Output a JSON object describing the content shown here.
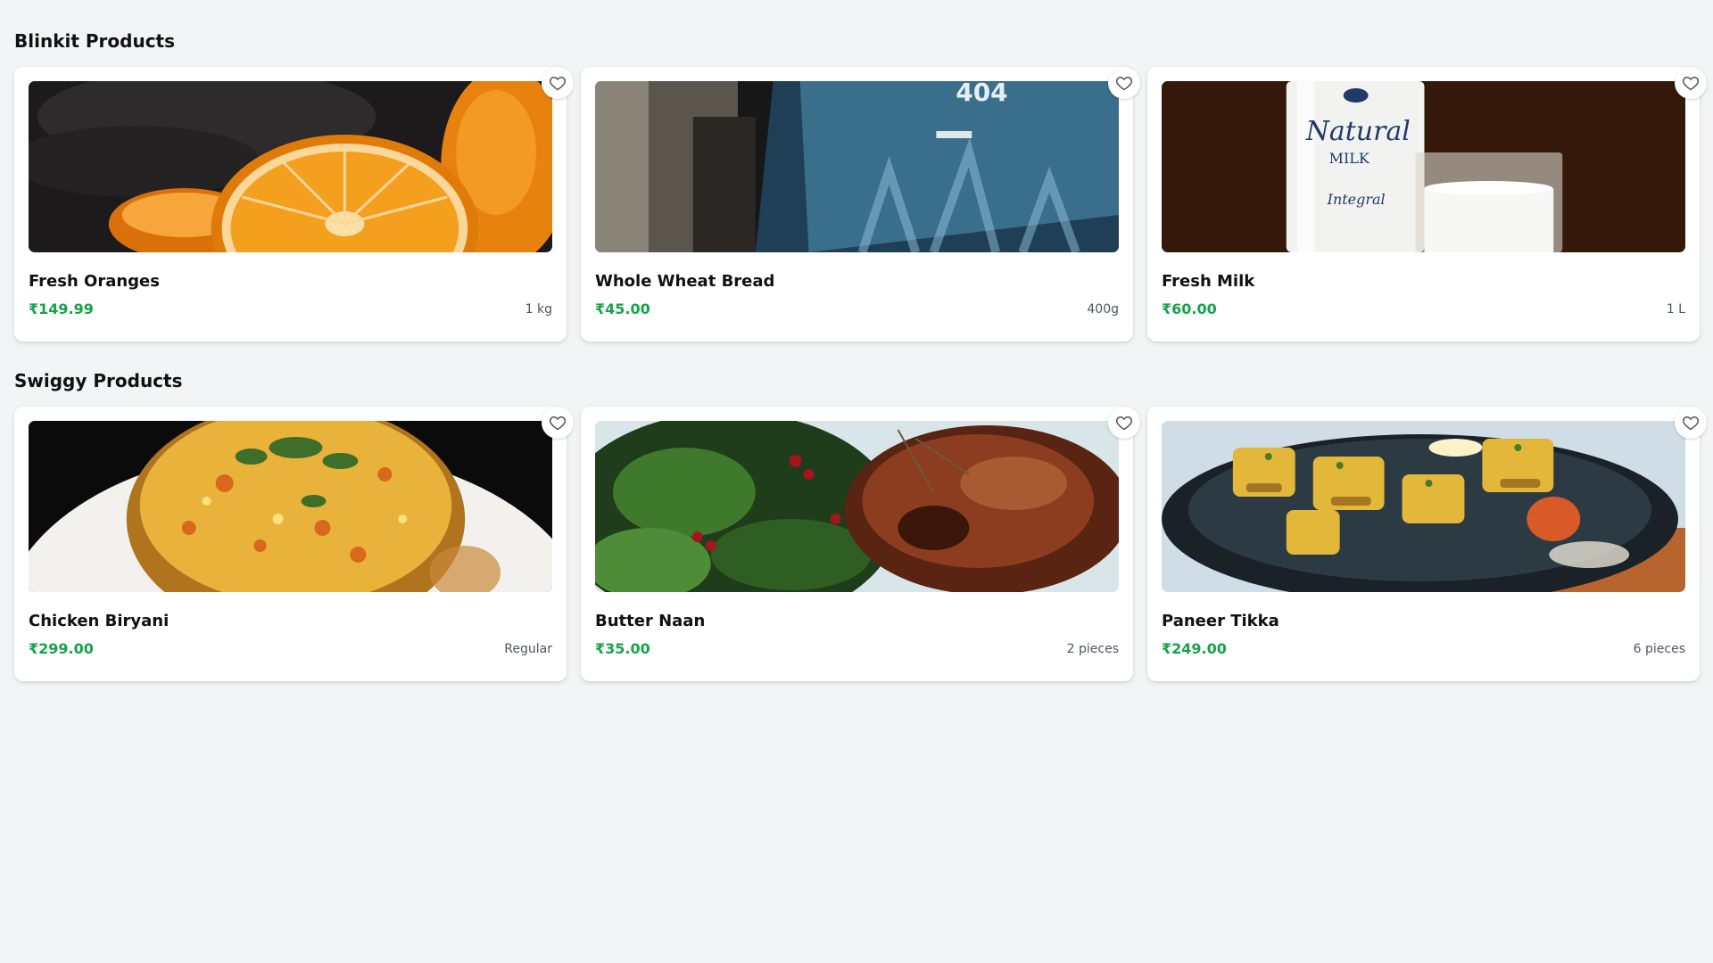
{
  "colors": {
    "background": "#f3f4f6",
    "card": "#ffffff",
    "price": "#16a34a",
    "muted": "#4b5563"
  },
  "sections": [
    {
      "title": "Blinkit Products",
      "products": [
        {
          "name": "Fresh Oranges",
          "price": "₹149.99",
          "quantity": "1 kg",
          "image": "oranges",
          "favorite_icon": "heart-outline-icon"
        },
        {
          "name": "Whole Wheat Bread",
          "price": "₹45.00",
          "quantity": "400g",
          "image": "laptop-404-screen",
          "image_text": "404",
          "favorite_icon": "heart-outline-icon"
        },
        {
          "name": "Fresh Milk",
          "price": "₹60.00",
          "quantity": "1 L",
          "image": "milk-bottle-and-glass",
          "image_text_1": "Natural",
          "image_text_2": "MILK",
          "image_text_3": "Integral",
          "favorite_icon": "heart-outline-icon"
        }
      ]
    },
    {
      "title": "Swiggy Products",
      "products": [
        {
          "name": "Chicken Biryani",
          "price": "₹299.00",
          "quantity": "Regular",
          "image": "biryani-bowl",
          "favorite_icon": "heart-outline-icon"
        },
        {
          "name": "Butter Naan",
          "price": "₹35.00",
          "quantity": "2 pieces",
          "image": "grilled-chicken-with-greens",
          "favorite_icon": "heart-outline-icon"
        },
        {
          "name": "Paneer Tikka",
          "price": "₹249.00",
          "quantity": "6 pieces",
          "image": "paneer-tikka-sizzler",
          "favorite_icon": "heart-outline-icon"
        }
      ]
    }
  ]
}
